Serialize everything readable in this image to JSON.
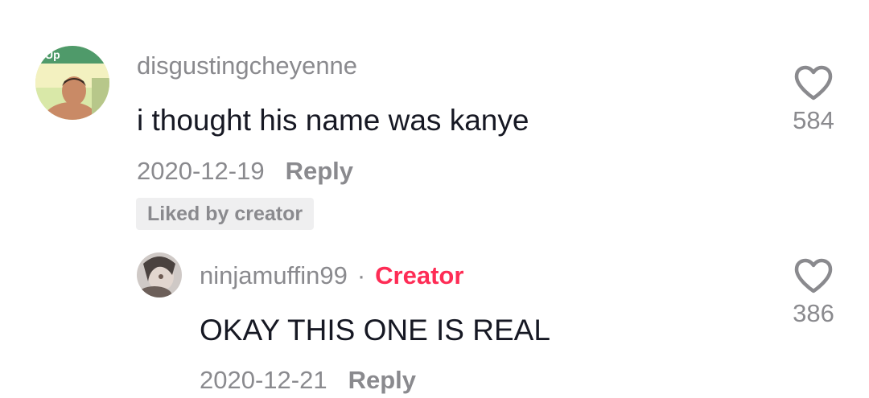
{
  "comments": [
    {
      "username": "disgustingcheyenne",
      "avatar_icon": "profile-photo",
      "avatar_text": "Up",
      "text": "i thought his name was kanye",
      "date": "2020-12-19",
      "reply_label": "Reply",
      "badge": "Liked by creator",
      "like_icon": "heart-outline-icon",
      "likes": "584"
    },
    {
      "username": "ninjamuffin99",
      "separator": "·",
      "creator_tag": "Creator",
      "avatar_icon": "profile-photo",
      "text": "OKAY THIS ONE IS REAL",
      "date": "2020-12-21",
      "reply_label": "Reply",
      "like_icon": "heart-outline-icon",
      "likes": "386"
    }
  ],
  "colors": {
    "text_primary": "#161823",
    "text_secondary": "#8a8a8e",
    "creator_accent": "#fe2c55",
    "badge_bg": "#efeff0"
  }
}
